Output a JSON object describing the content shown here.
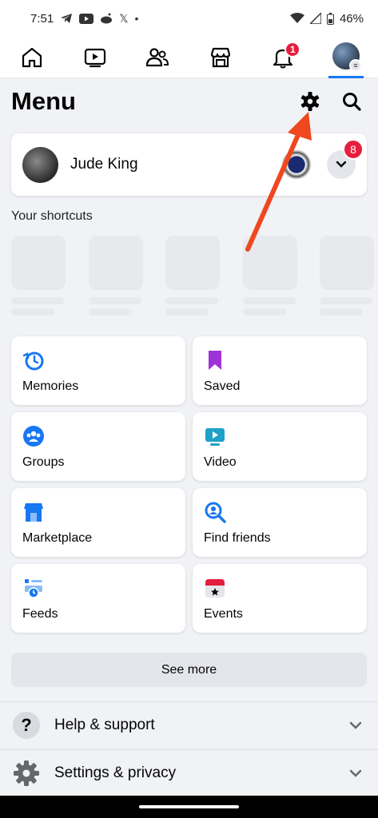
{
  "status_bar": {
    "time": "7:51",
    "battery": "46%",
    "left_icons": [
      "telegram-icon",
      "youtube-icon",
      "reddit-icon",
      "x-icon",
      "dot-icon"
    ],
    "right_icons": [
      "wifi-icon",
      "signal-icon",
      "battery-icon"
    ]
  },
  "nav": {
    "items": [
      {
        "name": "home",
        "icon": "home-icon"
      },
      {
        "name": "video",
        "icon": "video-icon"
      },
      {
        "name": "friends",
        "icon": "friends-icon"
      },
      {
        "name": "marketplace",
        "icon": "marketplace-icon"
      },
      {
        "name": "notifications",
        "icon": "bell-icon",
        "badge": "1"
      },
      {
        "name": "menu",
        "icon": "profile-avatar-icon"
      }
    ],
    "active": "menu"
  },
  "header": {
    "title": "Menu",
    "actions": [
      "gear-icon",
      "search-icon"
    ]
  },
  "profile": {
    "name": "Jude King",
    "notification_badge": "8"
  },
  "shortcuts": {
    "label": "Your shortcuts"
  },
  "grid": [
    {
      "label": "Memories",
      "icon": "memories-icon",
      "color": "#1877f2"
    },
    {
      "label": "Saved",
      "icon": "saved-icon",
      "color": "#a033d8"
    },
    {
      "label": "Groups",
      "icon": "groups-icon",
      "color": "#1877f2"
    },
    {
      "label": "Video",
      "icon": "video-icon",
      "color": "#1da1c9"
    },
    {
      "label": "Marketplace",
      "icon": "marketplace-icon",
      "color": "#1877f2"
    },
    {
      "label": "Find friends",
      "icon": "find-friends-icon",
      "color": "#1877f2"
    },
    {
      "label": "Feeds",
      "icon": "feeds-icon",
      "color": "#1877f2"
    },
    {
      "label": "Events",
      "icon": "events-icon",
      "color": "#e41e3f"
    }
  ],
  "see_more": "See more",
  "sections": [
    {
      "label": "Help & support",
      "icon": "help-icon"
    },
    {
      "label": "Settings & privacy",
      "icon": "settings-icon"
    }
  ],
  "colors": {
    "accent": "#1877f2",
    "badge": "#e41e3f",
    "annotation_arrow": "#f0471f",
    "background": "#f0f2f5"
  }
}
